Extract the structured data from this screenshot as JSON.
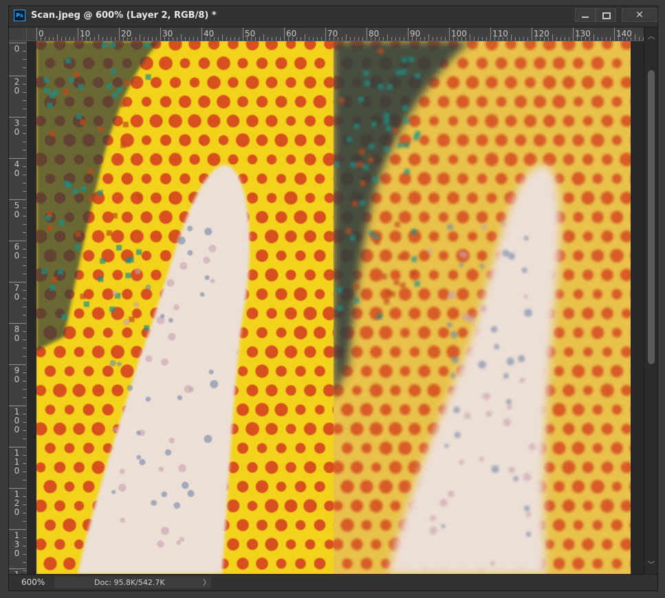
{
  "window": {
    "title": "Scan.jpeg @ 600% (Layer 2, RGB/8) *",
    "app_icon_text": "Ps",
    "close_glyph": "✕"
  },
  "rulers": {
    "unit": "pixels",
    "horizontal": {
      "labels": [
        "0",
        "10",
        "20",
        "30",
        "40",
        "50",
        "60",
        "70",
        "80",
        "90",
        "100",
        "110",
        "120",
        "130",
        "140"
      ]
    },
    "vertical": {
      "labels": [
        "0",
        "20",
        "30",
        "40",
        "50",
        "60",
        "70",
        "80",
        "90",
        "100",
        "110",
        "120",
        "130",
        "1"
      ]
    }
  },
  "status": {
    "zoom": "600%",
    "doc_info": "Doc: 95.8K/542.7K",
    "arrow": "〉"
  },
  "scrollbar": {
    "up_glyph": "︿",
    "down_glyph": "﹀"
  },
  "colors": {
    "halftone_yellow_sharp": "#f2d21a",
    "halftone_yellow_soft": "#e8c24a",
    "halftone_red": "#d23b1c",
    "halftone_dark": "#2c3a3c",
    "highlight_white": "#ecdfd6"
  }
}
